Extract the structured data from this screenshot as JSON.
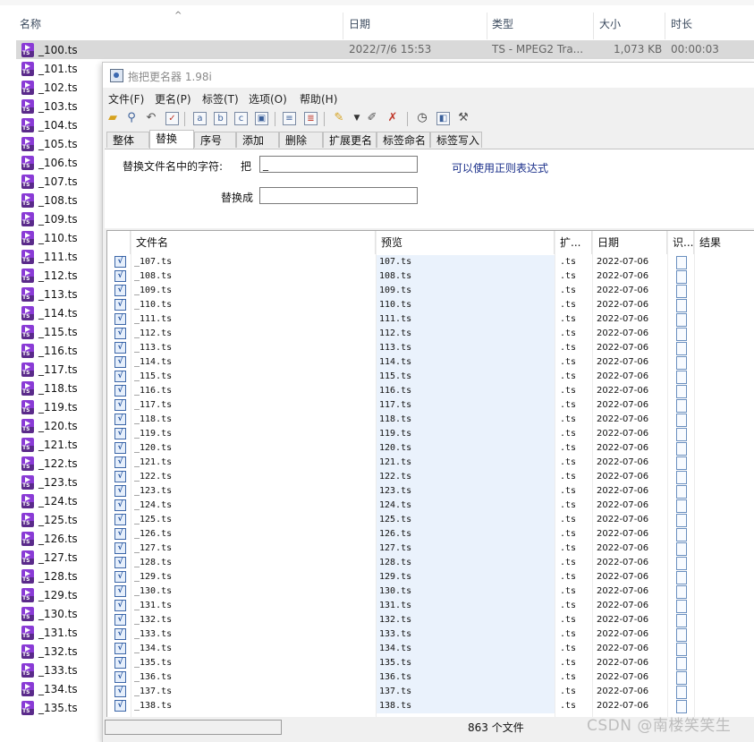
{
  "explorer": {
    "columns": {
      "name": "名称",
      "date": "日期",
      "type": "类型",
      "size": "大小",
      "duration": "时长"
    },
    "sort_glyph": "^",
    "selected_row": {
      "date": "2022/7/6 15:53",
      "type": "TS - MPEG2 Tra...",
      "size": "1,073 KB",
      "duration": "00:00:03"
    },
    "files": [
      "_100.ts",
      "_101.ts",
      "_102.ts",
      "_103.ts",
      "_104.ts",
      "_105.ts",
      "_106.ts",
      "_107.ts",
      "_108.ts",
      "_109.ts",
      "_110.ts",
      "_111.ts",
      "_112.ts",
      "_113.ts",
      "_114.ts",
      "_115.ts",
      "_116.ts",
      "_117.ts",
      "_118.ts",
      "_119.ts",
      "_120.ts",
      "_121.ts",
      "_122.ts",
      "_123.ts",
      "_124.ts",
      "_125.ts",
      "_126.ts",
      "_127.ts",
      "_128.ts",
      "_129.ts",
      "_130.ts",
      "_131.ts",
      "_132.ts",
      "_133.ts",
      "_134.ts",
      "_135.ts"
    ]
  },
  "renamer": {
    "title": "拖把更名器 1.98i",
    "menu": [
      "文件(F)",
      "更名(P)",
      "标签(T)",
      "选项(O)",
      "帮助(H)"
    ],
    "toolbar_icons": [
      "open-folder-icon",
      "search-icon",
      "undo-icon",
      "check-icon",
      "rename-icon",
      "rename-icon",
      "rename-icon",
      "save-icon",
      "list-icon",
      "export-icon",
      "brush-icon",
      "dropdown-icon",
      "edit-icon",
      "clear-icon",
      "clock-icon",
      "panel-icon",
      "tools-icon"
    ],
    "tabs": [
      "整体",
      "替换",
      "序号",
      "添加",
      "删除",
      "扩展更名",
      "标签命名",
      "标签写入"
    ],
    "active_tab": "替换",
    "replace_label": "替换文件名中的字符:",
    "from_label": "把",
    "from_value": "_",
    "to_label": "替换成",
    "to_value": "",
    "regex_link": "可以使用正则表达式",
    "table": {
      "headers": {
        "name": "文件名",
        "preview": "预览",
        "ext": "扩...",
        "date": "日期",
        "id": "识...",
        "result": "结果"
      },
      "date_value": "2022-07-06",
      "ext_value": ".ts",
      "check_glyph": "√",
      "rows": [
        {
          "name": "_107.ts",
          "preview": "107.ts"
        },
        {
          "name": "_108.ts",
          "preview": "108.ts"
        },
        {
          "name": "_109.ts",
          "preview": "109.ts"
        },
        {
          "name": "_110.ts",
          "preview": "110.ts"
        },
        {
          "name": "_111.ts",
          "preview": "111.ts"
        },
        {
          "name": "_112.ts",
          "preview": "112.ts"
        },
        {
          "name": "_113.ts",
          "preview": "113.ts"
        },
        {
          "name": "_114.ts",
          "preview": "114.ts"
        },
        {
          "name": "_115.ts",
          "preview": "115.ts"
        },
        {
          "name": "_116.ts",
          "preview": "116.ts"
        },
        {
          "name": "_117.ts",
          "preview": "117.ts"
        },
        {
          "name": "_118.ts",
          "preview": "118.ts"
        },
        {
          "name": "_119.ts",
          "preview": "119.ts"
        },
        {
          "name": "_120.ts",
          "preview": "120.ts"
        },
        {
          "name": "_121.ts",
          "preview": "121.ts"
        },
        {
          "name": "_122.ts",
          "preview": "122.ts"
        },
        {
          "name": "_123.ts",
          "preview": "123.ts"
        },
        {
          "name": "_124.ts",
          "preview": "124.ts"
        },
        {
          "name": "_125.ts",
          "preview": "125.ts"
        },
        {
          "name": "_126.ts",
          "preview": "126.ts"
        },
        {
          "name": "_127.ts",
          "preview": "127.ts"
        },
        {
          "name": "_128.ts",
          "preview": "128.ts"
        },
        {
          "name": "_129.ts",
          "preview": "129.ts"
        },
        {
          "name": "_130.ts",
          "preview": "130.ts"
        },
        {
          "name": "_131.ts",
          "preview": "131.ts"
        },
        {
          "name": "_132.ts",
          "preview": "132.ts"
        },
        {
          "name": "_133.ts",
          "preview": "133.ts"
        },
        {
          "name": "_134.ts",
          "preview": "134.ts"
        },
        {
          "name": "_135.ts",
          "preview": "135.ts"
        },
        {
          "name": "_136.ts",
          "preview": "136.ts"
        },
        {
          "name": "_137.ts",
          "preview": "137.ts"
        },
        {
          "name": "_138.ts",
          "preview": "138.ts"
        }
      ]
    },
    "status": {
      "count": "863 个文件"
    }
  },
  "watermark": "CSDN @南楼笑笑生",
  "colors": {
    "preview_bg": "#eaf2fc",
    "regex_link": "#1a2f8a",
    "ts_icon": "#8a3bd6"
  }
}
